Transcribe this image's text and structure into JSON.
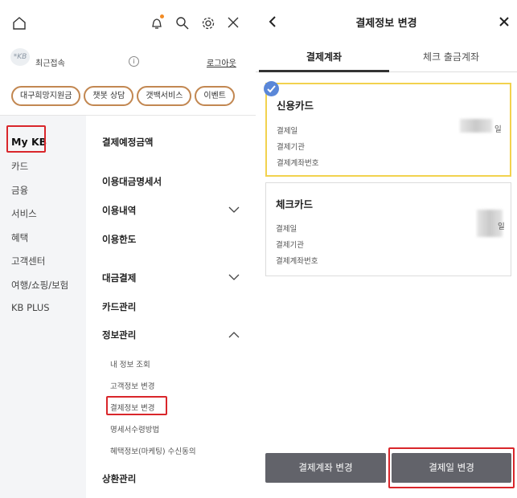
{
  "left": {
    "topbar": {
      "icons": [
        "home-icon",
        "bell-icon",
        "search-icon",
        "gear-icon",
        "close-icon"
      ],
      "notification_color": "#f28b24"
    },
    "user": {
      "avatar_text": "*KB",
      "recent_label": "최근접속",
      "info_glyph": "i",
      "logout": "로그아웃"
    },
    "chips": [
      "대구희망지원금",
      "챗봇 상담",
      "갯백서비스",
      "이벤트"
    ],
    "categories": [
      "My KB",
      "카드",
      "금융",
      "서비스",
      "혜택",
      "고객센터",
      "여행/쇼핑/보험",
      "KB PLUS"
    ],
    "menu": {
      "items": [
        "결제예정금액",
        "이용대금명세서",
        "이용내역",
        "이용한도",
        "대금결제",
        "카드관리",
        "정보관리",
        "상환관리"
      ],
      "sub_items": [
        "내 정보 조회",
        "고객정보 변경",
        "결제정보 변경",
        "명세서수령방법",
        "혜택정보(마케팅) 수신동의"
      ]
    },
    "highlight_color": "#d9262b",
    "chip_border_color": "#c28751"
  },
  "right": {
    "title": "결제정보 변경",
    "tabs": [
      "결제계좌",
      "체크 출금계좌"
    ],
    "cards": [
      {
        "title": "신용카드",
        "rows": [
          "결제일",
          "결제기관",
          "결제계좌번호"
        ],
        "day_suffix": "일",
        "selected": true
      },
      {
        "title": "체크카드",
        "rows": [
          "결제일",
          "결제기관",
          "결제계좌번호"
        ],
        "day_suffix": "일",
        "selected": false
      }
    ],
    "buttons": [
      "결제계좌 변경",
      "결제일 변경"
    ],
    "selected_border_color": "#f2d24e",
    "check_color": "#5a87d8",
    "button_color": "#62636a"
  }
}
